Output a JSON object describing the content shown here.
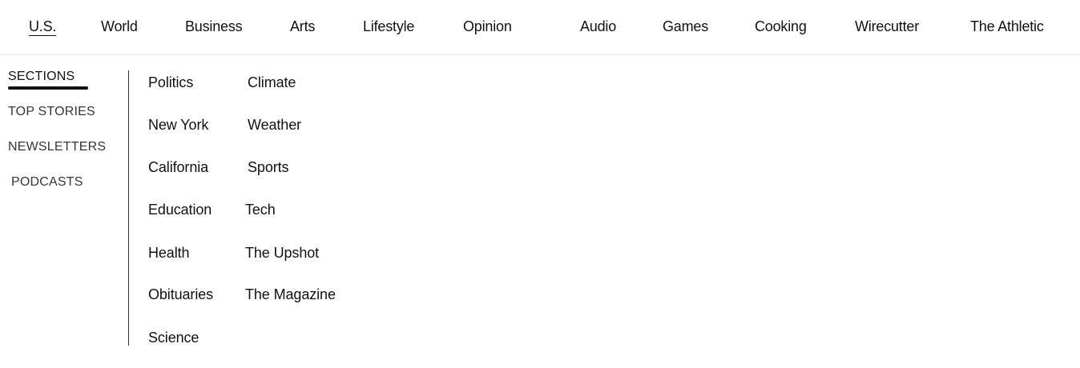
{
  "topnav": {
    "items": [
      {
        "label": "U.S.",
        "active": true
      },
      {
        "label": "World"
      },
      {
        "label": "Business"
      },
      {
        "label": "Arts"
      },
      {
        "label": "Lifestyle"
      },
      {
        "label": "Opinion"
      },
      {
        "label": "Audio"
      },
      {
        "label": "Games"
      },
      {
        "label": "Cooking"
      },
      {
        "label": "Wirecutter"
      },
      {
        "label": "The Athletic"
      }
    ]
  },
  "section_tabs": {
    "items": [
      {
        "label": "SECTIONS",
        "active": true
      },
      {
        "label": "TOP STORIES"
      },
      {
        "label": "NEWSLETTERS"
      },
      {
        "label": "PODCASTS"
      }
    ]
  },
  "sections": {
    "column1": [
      "Politics",
      "New York",
      "California",
      "Education",
      "Health",
      "Obituaries",
      "Science"
    ],
    "column2": [
      "Climate",
      "Weather",
      "Sports",
      "Tech",
      "The Upshot",
      "The Magazine"
    ]
  }
}
